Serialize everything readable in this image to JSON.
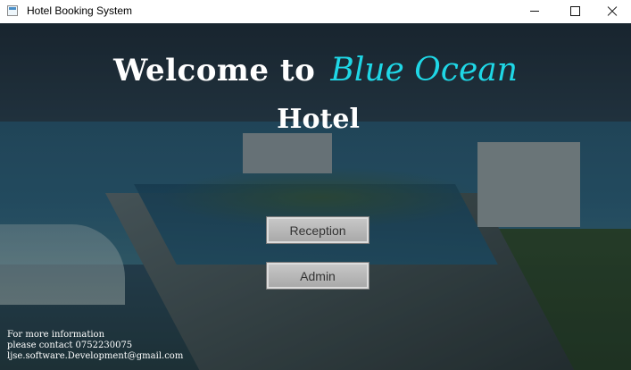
{
  "window": {
    "title": "Hotel Booking System",
    "icon": "app-window-icon",
    "controls": [
      "minimize-icon",
      "maximize-icon",
      "close-icon"
    ]
  },
  "hero": {
    "welcome": "Welcome to",
    "brand": "Blue Ocean",
    "subtitle": "Hotel",
    "brand_color": "#1fd7e6"
  },
  "buttons": {
    "reception": "Reception",
    "admin": "Admin"
  },
  "contact": {
    "line1": "For more information",
    "line2": "please contact  0752230075",
    "line3": "ljse.software.Development@gmail.com"
  }
}
